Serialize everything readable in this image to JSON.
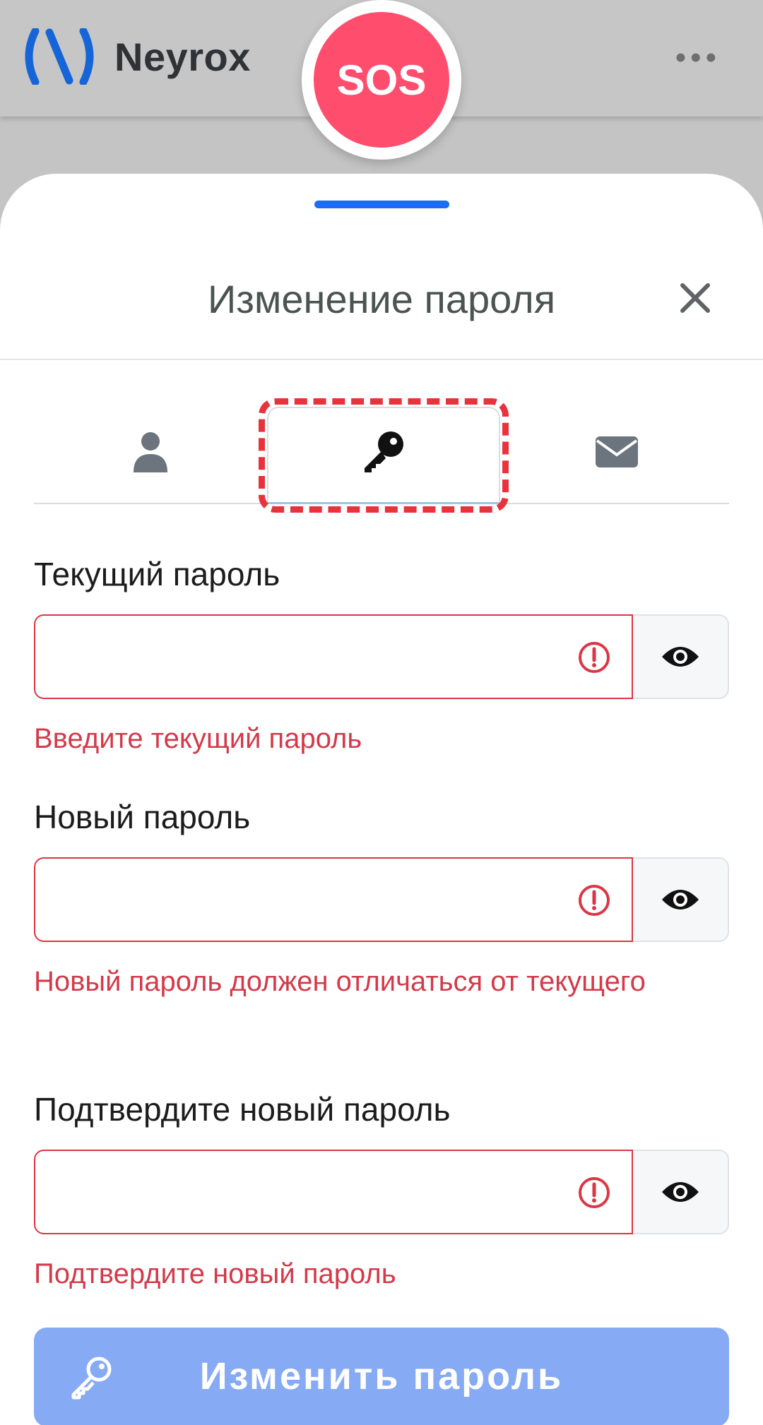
{
  "header": {
    "brand": "Neyrox",
    "logo_icon": "neyrox-logo-icon",
    "more_icon": "more-dots-icon",
    "sos_label": "SOS"
  },
  "sheet": {
    "title": "Изменение пароля",
    "close_icon": "close-icon"
  },
  "tabs": [
    {
      "icon": "user-icon",
      "active": false
    },
    {
      "icon": "key-icon",
      "active": true
    },
    {
      "icon": "envelope-icon",
      "active": false
    }
  ],
  "form": {
    "current": {
      "label": "Текущий пароль",
      "value": "",
      "error": "Введите текущий пароль"
    },
    "new": {
      "label": "Новый пароль",
      "value": "",
      "error": "Новый пароль должен отличаться от текущего"
    },
    "confirm": {
      "label": "Подтвердите новый пароль",
      "value": "",
      "error": "Подтвердите новый пароль"
    }
  },
  "submit": {
    "label": "Изменить пароль",
    "icon": "key-icon"
  },
  "colors": {
    "accent": "#1b6ef3",
    "sos": "#ff4d6d",
    "error": "#dc3545",
    "submit_bg": "#86aaf3",
    "highlight_frame": "#e8323c"
  }
}
